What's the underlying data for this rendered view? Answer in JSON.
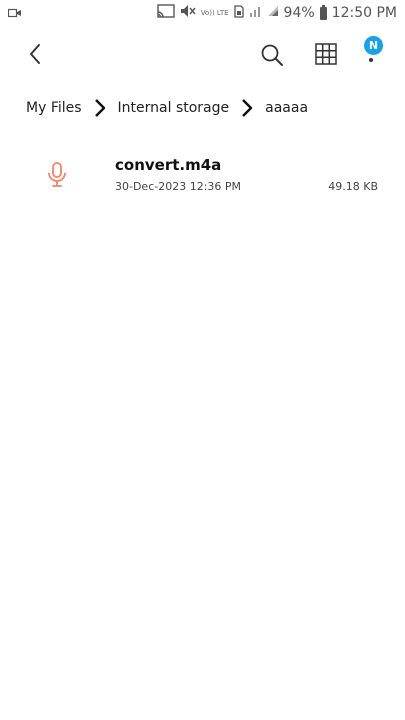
{
  "status_bar": {
    "battery_percent": "94%",
    "time": "12:50 PM",
    "volte_label": "Vo)) LTE",
    "icons": [
      "video-camera-icon",
      "cast-icon",
      "mute-icon",
      "volte-icon",
      "sim-icon",
      "signal-icon",
      "signal-icon-2",
      "battery-icon"
    ]
  },
  "toolbar": {
    "icons": [
      "back-arrow-icon",
      "search-icon",
      "grid-view-icon",
      "more-options-icon"
    ],
    "notification_badge": "N",
    "badge_color": "#19a1e8"
  },
  "breadcrumb": {
    "items": [
      "My Files",
      "Internal storage",
      "aaaaa"
    ]
  },
  "files": [
    {
      "name": "convert.m4a",
      "date": "30-Dec-2023 12:36 PM",
      "size": "49.18 KB",
      "icon": "microphone-icon",
      "icon_color": "#e8876a"
    }
  ]
}
